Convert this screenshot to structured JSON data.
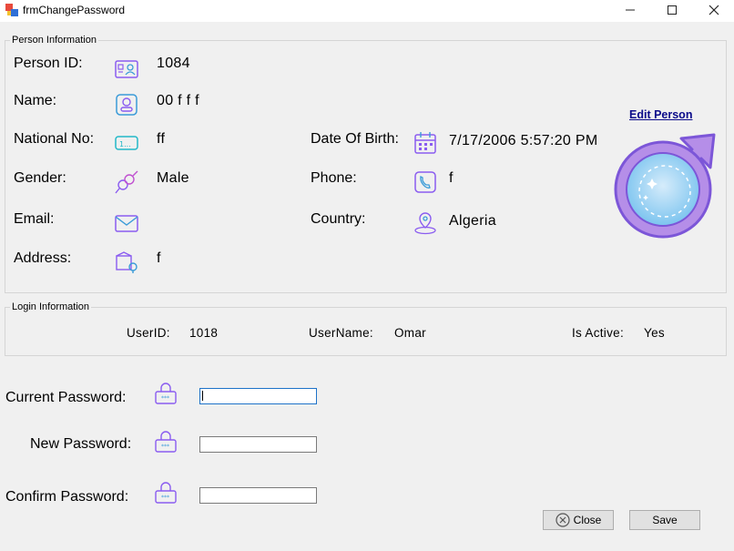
{
  "window": {
    "title": "frmChangePassword",
    "minimize": "—",
    "maximize": "☐",
    "close": "✕"
  },
  "person_info": {
    "group_label": "Person Information",
    "edit_link": "Edit Person ",
    "fields": {
      "person_id": {
        "label": "Person ID:",
        "value": "1084",
        "icon": "id-card-icon"
      },
      "name": {
        "label": "Name:",
        "value": "00 f f f",
        "icon": "person-badge-icon"
      },
      "national_no": {
        "label": "National No:",
        "value": "ff",
        "icon": "national-number-icon"
      },
      "gender": {
        "label": "Gender:",
        "value": "Male",
        "icon": "gender-icon"
      },
      "email": {
        "label": "Email:",
        "value": "",
        "icon": "envelope-icon"
      },
      "address": {
        "label": "Address:",
        "value": "f",
        "icon": "address-location-icon"
      },
      "date_of_birth": {
        "label": "Date Of Birth:",
        "value": "7/17/2006 5:57:20 PM",
        "icon": "calendar-icon"
      },
      "phone": {
        "label": "Phone:",
        "value": "f",
        "icon": "phone-icon"
      },
      "country": {
        "label": "Country:",
        "value": "Algeria",
        "icon": "globe-location-icon"
      }
    },
    "gender_image": "male-symbol-image"
  },
  "login_info": {
    "group_label": "Login Information",
    "user_id_label": "UserID:",
    "user_id": "1018",
    "username_label": "UserName:",
    "username": "Omar",
    "is_active_label": "Is Active:",
    "is_active": "Yes"
  },
  "password_form": {
    "current_label": "Current Password:",
    "new_label": "New Password:",
    "confirm_label": "Confirm Password:",
    "current_value": "",
    "new_value": "",
    "confirm_value": "",
    "icon": "password-lock-icon"
  },
  "buttons": {
    "close_label": "Close",
    "save_label": "Save",
    "close_icon": "close-circle-icon"
  },
  "colors": {
    "accent_purple": "#8a5cf0",
    "accent_blue": "#3a9bd8",
    "link": "#0b0b8a",
    "focus_border": "#1e72c8"
  }
}
